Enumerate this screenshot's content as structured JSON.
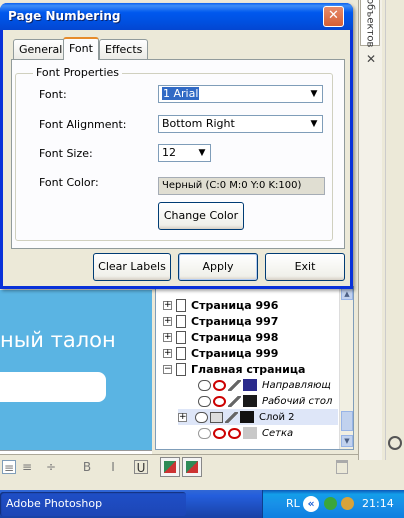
{
  "dialog": {
    "title": "Page Numbering",
    "close_glyph": "✕",
    "tabs": [
      "General",
      "Font",
      "Effects"
    ],
    "active_tab": "Font",
    "group_title": "Font Properties",
    "font_label": "Font:",
    "font_value": "1 Arial",
    "alignment_label": "Font Alignment:",
    "alignment_value": "Bottom Right",
    "size_label": "Font Size:",
    "size_value": "12",
    "color_label": "Font Color:",
    "color_value": "Черный (C:0 M:0 Y:0 K:100)",
    "change_color_button": "Change Color",
    "clear_labels_button": "Clear Labels",
    "apply_button": "Apply",
    "exit_button": "Exit"
  },
  "docker": {
    "tab_label": "объектов",
    "close_glyph": "✕"
  },
  "canvas": {
    "text": "ный талон",
    "color": "#5AB4E3"
  },
  "pages": {
    "items": [
      {
        "label": "Страница 996",
        "expander": "+"
      },
      {
        "label": "Страница 997",
        "expander": "+"
      },
      {
        "label": "Страница 998",
        "expander": "+"
      },
      {
        "label": "Страница 999",
        "expander": "+"
      },
      {
        "label": "Главная страница",
        "expander": "−"
      }
    ],
    "layers": [
      {
        "label": "Направляющ",
        "color": "#2B2B8C"
      },
      {
        "label": "Рабочий стол",
        "color": "#1A1A1A"
      },
      {
        "label": "Слой 2",
        "color": "#111111"
      },
      {
        "label": "Сетка",
        "color": "#C8C8C8"
      }
    ]
  },
  "taskbar": {
    "app_button": "Adobe Photoshop",
    "language": "RL",
    "tray_arrow": "«",
    "clock": "21:14"
  }
}
